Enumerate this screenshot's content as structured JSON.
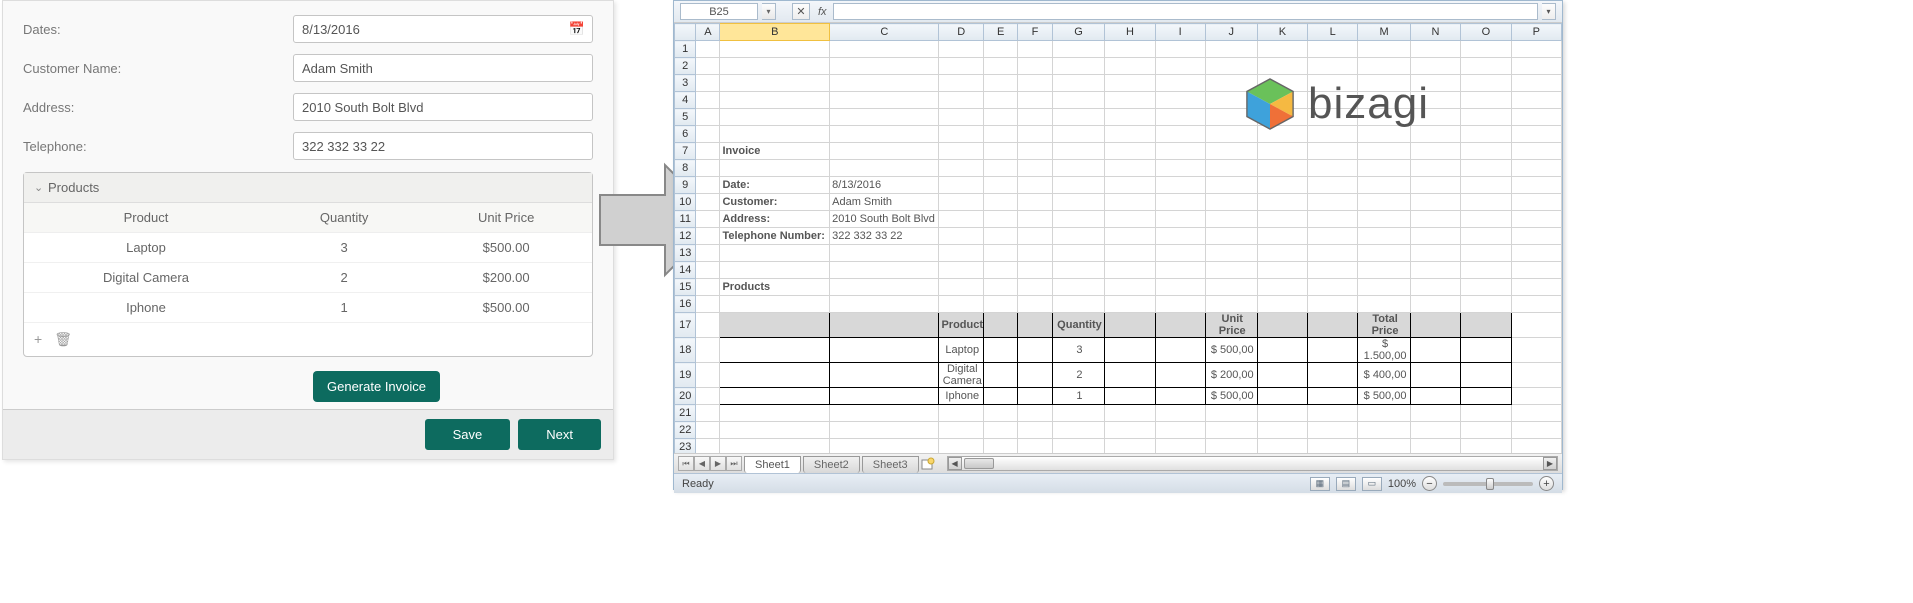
{
  "form": {
    "labels": {
      "dates": "Dates:",
      "customer": "Customer Name:",
      "address": "Address:",
      "telephone": "Telephone:",
      "generate_invoice_label": "Generate Invoice:"
    },
    "values": {
      "dates": "8/13/2016",
      "customer": "Adam Smith",
      "address": "2010 South Bolt Blvd",
      "telephone": "322 332 33 22"
    },
    "products": {
      "title": "Products",
      "headers": [
        "Product",
        "Quantity",
        "Unit Price"
      ],
      "rows": [
        {
          "product": "Laptop",
          "qty": "3",
          "price": "$500.00"
        },
        {
          "product": "Digital Camera",
          "qty": "2",
          "price": "$200.00"
        },
        {
          "product": "Iphone",
          "qty": "1",
          "price": "$500.00"
        }
      ]
    },
    "buttons": {
      "generate": "Generate Invoice",
      "save": "Save",
      "next": "Next"
    },
    "template_link": "Template.xlsx"
  },
  "excel": {
    "name_box": "B25",
    "fx": "fx",
    "columns": [
      "A",
      "B",
      "C",
      "D",
      "E",
      "F",
      "G",
      "H",
      "I",
      "J",
      "K",
      "L",
      "M",
      "N",
      "O",
      "P"
    ],
    "row_count": 25,
    "selected_col": "B",
    "invoice": {
      "title": "Invoice",
      "labels": {
        "date": "Date:",
        "customer": "Customer:",
        "address": "Address:",
        "tel": "Telephone Number:"
      },
      "values": {
        "date": "8/13/2016",
        "customer": "Adam Smith",
        "address": "2010 South Bolt Blvd",
        "tel": "322 332 33 22"
      },
      "products_title": "Products",
      "table_headers": [
        "Product",
        "Quantity",
        "Unit Price",
        "Total Price"
      ],
      "table_rows": [
        {
          "product": "Laptop",
          "qty": "3",
          "unit": "$ 500,00",
          "total": "$ 1.500,00"
        },
        {
          "product": "Digital Camera",
          "qty": "2",
          "unit": "$ 200,00",
          "total": "$ 400,00"
        },
        {
          "product": "Iphone",
          "qty": "1",
          "unit": "$ 500,00",
          "total": "$ 500,00"
        }
      ]
    },
    "sheets": [
      "Sheet1",
      "Sheet2",
      "Sheet3"
    ],
    "status": "Ready",
    "zoom": "100%",
    "logo": "bizagi"
  }
}
